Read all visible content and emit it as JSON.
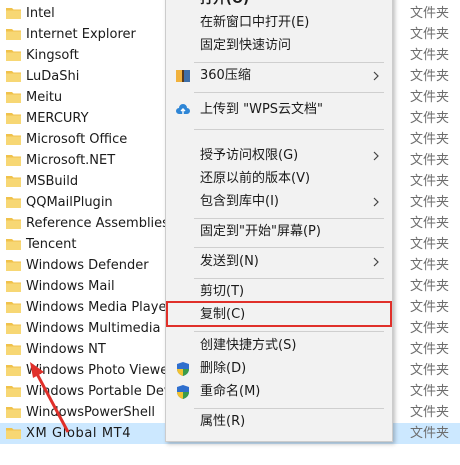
{
  "files": [
    {
      "name": "Intel",
      "type": "文件夹"
    },
    {
      "name": "Internet Explorer",
      "type": "文件夹"
    },
    {
      "name": "Kingsoft",
      "type": "文件夹"
    },
    {
      "name": "LuDaShi",
      "type": "文件夹"
    },
    {
      "name": "Meitu",
      "type": "文件夹"
    },
    {
      "name": "MERCURY",
      "type": "文件夹"
    },
    {
      "name": "Microsoft Office",
      "type": "文件夹"
    },
    {
      "name": "Microsoft.NET",
      "type": "文件夹"
    },
    {
      "name": "MSBuild",
      "type": "文件夹"
    },
    {
      "name": "QQMailPlugin",
      "type": "文件夹"
    },
    {
      "name": "Reference Assemblies",
      "type": "文件夹"
    },
    {
      "name": "Tencent",
      "type": "文件夹"
    },
    {
      "name": "Windows Defender",
      "type": "文件夹"
    },
    {
      "name": "Windows Mail",
      "type": "文件夹"
    },
    {
      "name": "Windows Media Player",
      "type": "文件夹"
    },
    {
      "name": "Windows Multimedia Pla",
      "type": "文件夹"
    },
    {
      "name": "Windows NT",
      "type": "文件夹"
    },
    {
      "name": "Windows Photo Viewer",
      "type": "文件夹"
    },
    {
      "name": "Windows Portable Devic",
      "type": "文件夹"
    },
    {
      "name": "WindowsPowerShell",
      "type": "文件夹"
    },
    {
      "name": "XM Global MT4",
      "type": "文件夹"
    }
  ],
  "menu": {
    "open": "打开(O)",
    "open_new_window": "在新窗口中打开(E)",
    "pin_quick_access": "固定到快速访问",
    "compress_360": "360压缩",
    "upload_wps": "上传到 \"WPS云文档\"",
    "grant_access": "授予访问权限(G)",
    "restore_versions": "还原以前的版本(V)",
    "include_library": "包含到库中(I)",
    "pin_start": "固定到\"开始\"屏幕(P)",
    "send_to": "发送到(N)",
    "cut": "剪切(T)",
    "copy": "复制(C)",
    "create_shortcut": "创建快捷方式(S)",
    "delete": "删除(D)",
    "rename": "重命名(M)",
    "properties": "属性(R)"
  },
  "colors": {
    "folder": "#f0c24b",
    "selection": "#cce8ff",
    "highlight": "#e0302a",
    "upload": "#2f86d6"
  }
}
